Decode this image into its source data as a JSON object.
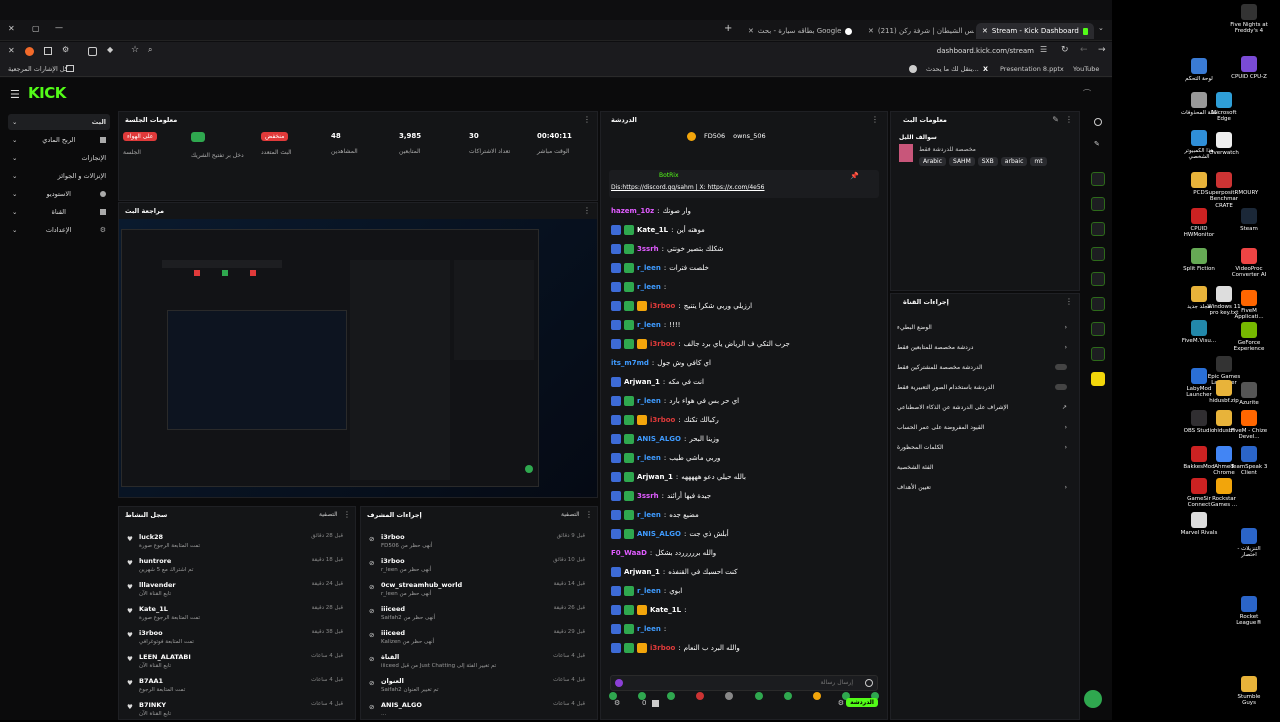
{
  "browser": {
    "tabs": [
      {
        "label": "Stream - Kick Dashboard",
        "active": true
      },
      {
        "label": "(211) مجلس الشيطان | شرفة ركن",
        "active": false
      },
      {
        "label": "بطاقه سيارة - بحث Google",
        "active": false
      }
    ],
    "url": "dashboard.kick.com/stream",
    "bookmarks_left": "كل الإشارات المرجعية",
    "bookmarks_right": [
      "YouTube",
      "Presentation 8.pptx",
      "X",
      "ينقل لك ما يحدث..."
    ]
  },
  "kick": {
    "logo": "KICK",
    "nav": [
      {
        "label": "البث",
        "active": true
      },
      {
        "label": "الربح المادي"
      },
      {
        "label": "الإنجازات"
      },
      {
        "label": "الإنزالات و الجوائز"
      },
      {
        "label": "الاستوديو"
      },
      {
        "label": "القناة"
      },
      {
        "label": "الإعدادات"
      }
    ],
    "session": {
      "title": "معلومات الجلسة",
      "stats": [
        {
          "badge": "على الهواء",
          "badge_color": "#e03a3a",
          "label": "الجلسة"
        },
        {
          "badge": "",
          "badge_color": "#2fa84f",
          "label": "دخل بر تفتيح الشريك"
        },
        {
          "badge": "منخفض",
          "badge_color": "#e03a3a",
          "label": "البث المتعدد"
        },
        {
          "value": "48",
          "label": "المشاهدين"
        },
        {
          "value": "3,985",
          "label": "المتابعين"
        },
        {
          "value": "30",
          "label": "تعداد الاشتراكات"
        },
        {
          "value": "00:40:11",
          "label": "الوقت مباشر"
        }
      ]
    },
    "preview": {
      "title": "مراجعة البث"
    },
    "activity": {
      "title": "سجل النشاط",
      "filter": "التصفية",
      "items": [
        {
          "name": "luck28",
          "sub": "تمت المتابعة الرجوع صورة",
          "time": "قبل 28 دقائق"
        },
        {
          "name": "huntrore",
          "sub": "تم اشتراك مع 5 شهرين",
          "time": "قبل 18 دقيقة"
        },
        {
          "name": "lllavender",
          "sub": "تابع القناة الآن",
          "time": "قبل 24 دقيقة"
        },
        {
          "name": "Kate_1L",
          "sub": "تمت المتابعة الرجوع صورة",
          "time": "قبل 28 دقيقة"
        },
        {
          "name": "i3rboo",
          "sub": "تمت المتابعة فوتوغرافي",
          "time": "قبل 38 دقيقة"
        },
        {
          "name": "LEEN_ALATABI",
          "sub": "تابع القناة الآن",
          "time": "قبل 4 ساعات"
        },
        {
          "name": "B7AA1",
          "sub": "تمت المتابعة الرجوع",
          "time": "قبل 4 ساعات"
        },
        {
          "name": "B7INKY",
          "sub": "تابع القناة الآن",
          "time": "قبل 4 ساعات"
        }
      ]
    },
    "modactions": {
      "title": "إجراءات المشرف",
      "filter": "التصفية",
      "items": [
        {
          "name": "i3rboo",
          "sub": "FD506 أنهى حظر من",
          "time": "قبل 9 دقائق"
        },
        {
          "name": "i3rboo",
          "sub": "r_leen أنهى حظر من",
          "time": "قبل 10 دقائق"
        },
        {
          "name": "0cw_streamhub_world",
          "sub": "r_leen أنهى حظر من",
          "time": "قبل 14 دقيقة"
        },
        {
          "name": "iiiceed",
          "sub": "Saifah2 أنهى حظر من",
          "time": "قبل 26 دقيقة"
        },
        {
          "name": "iiiceed",
          "sub": "Kalizen أنهى حظر من",
          "time": "قبل 29 دقيقة"
        },
        {
          "name": "القناة",
          "sub": "iiiceed من قبل Just Chatting تم تغيير الفئة إلى",
          "time": "قبل 4 ساعات"
        },
        {
          "name": "العنوان",
          "sub": "Saifah2 تم تغيير العنوان",
          "time": "قبل 4 ساعات"
        },
        {
          "name": "ANIS_ALGO",
          "sub": "...",
          "time": "قبل 4 ساعات"
        }
      ]
    },
    "chat": {
      "title": "الدردشة",
      "top_users": [
        "FD506",
        "owns_506"
      ],
      "pinned_by": "BotRix",
      "pinned_text": "Dis:https://discord.gg/sahm | X: https://x.com/4e56",
      "messages": [
        {
          "user": "hazem_10z",
          "color": "#e05cff",
          "text": "وار صوتك",
          "badges": 0
        },
        {
          "user": "Kate_1L",
          "color": "#ffffff",
          "text": "موهته أين",
          "badges": 2
        },
        {
          "user": "3ssrh",
          "color": "#e05cff",
          "text": "شكلك بتصير خونتي",
          "badges": 2
        },
        {
          "user": "r_leen",
          "color": "#3f9bff",
          "text": "خلصت فترات",
          "badges": 2
        },
        {
          "user": "r_leen",
          "color": "#3f9bff",
          "text": "",
          "badges": 2
        },
        {
          "user": "i3rboo",
          "color": "#e03a3a",
          "text": "ارزيلي وربي شكرا يتنيج",
          "badges": 3
        },
        {
          "user": "r_leen",
          "color": "#3f9bff",
          "text": "!!!!",
          "badges": 2
        },
        {
          "user": "i3rboo",
          "color": "#e03a3a",
          "text": "جرب التكي ف الرياض ياي برد جالف",
          "badges": 3
        },
        {
          "user": "its_m7md",
          "color": "#3f9bff",
          "text": "اي كافي وش جول",
          "badges": 0
        },
        {
          "user": "Arjwan_1",
          "color": "#ffffff",
          "text": "انت في مكه",
          "badges": 1
        },
        {
          "user": "r_leen",
          "color": "#3f9bff",
          "text": "اي حر بس في هواء بارد",
          "badges": 2
        },
        {
          "user": "i3rboo",
          "color": "#e03a3a",
          "text": "ركبالك تكتك",
          "badges": 3
        },
        {
          "user": "ANIS_ALGO",
          "color": "#3f9bff",
          "text": "وزينا البحر",
          "badges": 2
        },
        {
          "user": "r_leen",
          "color": "#3f9bff",
          "text": "وربي ماشي طيب",
          "badges": 2
        },
        {
          "user": "Arjwan_1",
          "color": "#ffffff",
          "text": "بالله حيلي دعو هههههه",
          "badges": 2
        },
        {
          "user": "3ssrh",
          "color": "#e05cff",
          "text": "جيدة فيها أرائند",
          "badges": 2
        },
        {
          "user": "r_leen",
          "color": "#3f9bff",
          "text": "مضيع جده",
          "badges": 2
        },
        {
          "user": "ANIS_ALGO",
          "color": "#3f9bff",
          "text": "أبلش ذي جت",
          "badges": 2
        },
        {
          "user": "F0_WaaD",
          "color": "#e05cff",
          "text": "والله بررررردد بشكل",
          "badges": 0
        },
        {
          "user": "Arjwan_1",
          "color": "#ffffff",
          "text": "كنت احسبك في القنفذه",
          "badges": 1
        },
        {
          "user": "r_leen",
          "color": "#3f9bff",
          "text": "ابوي",
          "badges": 2
        },
        {
          "user": "Kate_1L",
          "color": "#ffffff",
          "text": "",
          "badges": 3
        },
        {
          "user": "r_leen",
          "color": "#3f9bff",
          "text": "",
          "badges": 2
        },
        {
          "user": "i3rboo",
          "color": "#e03a3a",
          "text": "والله البرد ب النعام",
          "badges": 3
        }
      ],
      "input_placeholder": "إرسال رسالة",
      "send_label": "الدردشة",
      "count": "0"
    },
    "stream_info": {
      "title": "معلومات البث",
      "category_label": "سوالف الليل",
      "subtitle": "مخصصة للدردشة فقط",
      "tags": [
        "Arabic",
        "SAHM",
        "SXB",
        "arbaic",
        "mt"
      ]
    },
    "quick_actions": {
      "title": "إجراءات القناة",
      "items": [
        {
          "label": "الوضع البطيء",
          "type": "chevron"
        },
        {
          "label": "دردشة مخصصة للمتابعين فقط",
          "type": "chevron"
        },
        {
          "label": "الدردشة مخصصة للمشتركين فقط",
          "type": "toggle"
        },
        {
          "label": "الدردشة باستخدام الصور التعبيرية فقط",
          "type": "toggle"
        },
        {
          "label": "الإشراف على الدردشة عن الذكاء الاصطناعي",
          "type": "link"
        },
        {
          "label": "القيود المفروضة على عمر الحساب",
          "type": "chevron"
        },
        {
          "label": "الكلمات المحظورة",
          "type": "chevron"
        },
        {
          "label": "الفئة الشخصية",
          "type": "text"
        },
        {
          "label": "تعيين الأهداف",
          "type": "chevron"
        }
      ]
    }
  },
  "desktop": {
    "icons": [
      {
        "label": "Five Nights at Freddy's 4",
        "color": "#333"
      },
      {
        "label": "لوحة التحكم",
        "color": "#3a7bd5"
      },
      {
        "label": "CPUID CPU-Z",
        "color": "#7a4bd6"
      },
      {
        "label": "سلة المحذوفات",
        "color": "#999"
      },
      {
        "label": "Microsoft Edge",
        "color": "#2f9fd8"
      },
      {
        "label": "هذا الكمبيوتر الشخصي",
        "color": "#2f8fd8"
      },
      {
        "label": "Overwatch",
        "color": "#eee"
      },
      {
        "label": "PCD",
        "color": "#e8b33a"
      },
      {
        "label": "SuperpositRMOURY Benchmar CRATE",
        "color": "#c33"
      },
      {
        "label": "CPUID HWMonitor",
        "color": "#c22"
      },
      {
        "label": "Steam",
        "color": "#1b2838"
      },
      {
        "label": "Split Fiction",
        "color": "#6a5"
      },
      {
        "label": "VideoProc Converter AI",
        "color": "#e44"
      },
      {
        "label": "مجلد جديد",
        "color": "#e8b33a"
      },
      {
        "label": "Windows 11 pro key.txt",
        "color": "#ddd"
      },
      {
        "label": "FiveM Applicati...",
        "color": "#f60"
      },
      {
        "label": "FiveM.Visu...",
        "color": "#28a"
      },
      {
        "label": "GeForce Experience",
        "color": "#76b900"
      },
      {
        "label": "Epic Games Launcher",
        "color": "#333"
      },
      {
        "label": "LabyMod Launcher",
        "color": "#2a6fd6"
      },
      {
        "label": "hidusbf.zip",
        "color": "#e8b33a"
      },
      {
        "label": "Azurite",
        "color": "#555"
      },
      {
        "label": "OBS Studio",
        "color": "#302e31"
      },
      {
        "label": "hidusbf",
        "color": "#e8b33a"
      },
      {
        "label": "FiveM - Chize Devel...",
        "color": "#f60"
      },
      {
        "label": "BakkesMod",
        "color": "#c22"
      },
      {
        "label": "Ahmed Chrome",
        "color": "#4285f4"
      },
      {
        "label": "TeamSpeak 3 Client",
        "color": "#2b65c9"
      },
      {
        "label": "GameSir Connect",
        "color": "#c22"
      },
      {
        "label": "Rockstar Games ...",
        "color": "#f2a50b"
      },
      {
        "label": "Marvel Rivals",
        "color": "#ddd"
      },
      {
        "label": "التنزيلات - اختصار",
        "color": "#2b65c9"
      },
      {
        "label": "Rocket League®",
        "color": "#2b65c9"
      },
      {
        "label": "Stumble Guys",
        "color": "#e8b33a"
      }
    ]
  }
}
